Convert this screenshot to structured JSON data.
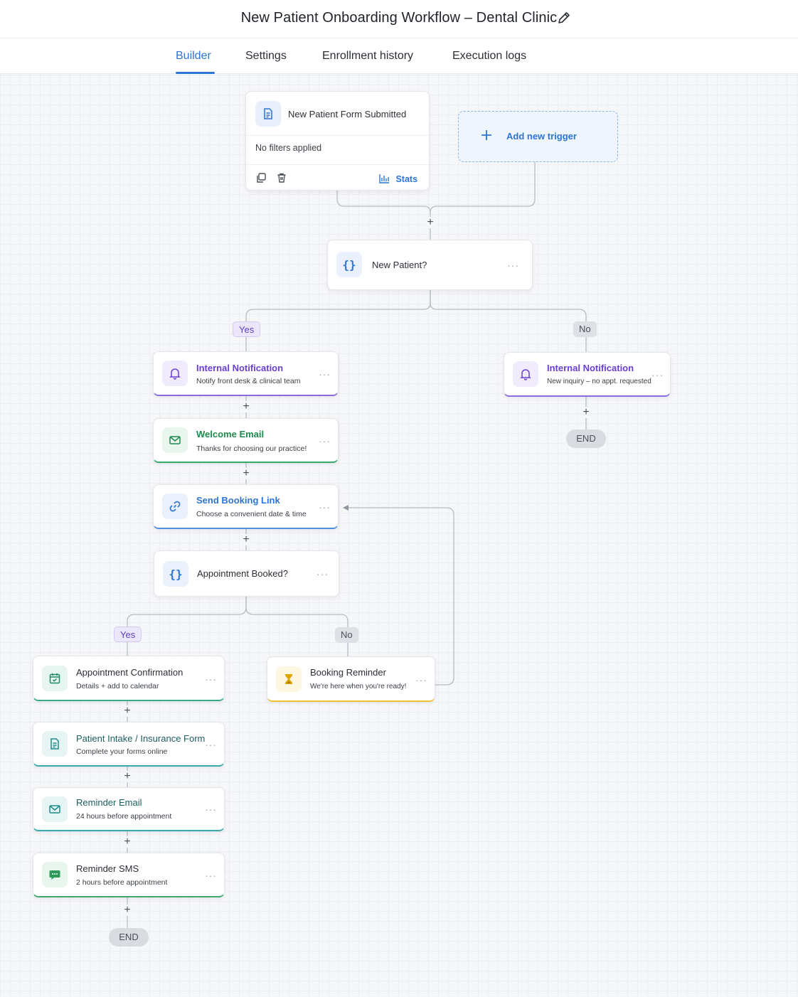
{
  "header": {
    "title": "New Patient Onboarding Workflow – Dental Clinic",
    "edit_icon": "pencil-icon"
  },
  "tabs": [
    {
      "label": "Builder",
      "active": true
    },
    {
      "label": "Settings",
      "active": false
    },
    {
      "label": "Enrollment history",
      "active": false
    },
    {
      "label": "Execution logs",
      "active": false
    }
  ],
  "trigger": {
    "title": "New Patient Form Submitted",
    "icon": "document-icon",
    "filters": "No filters applied",
    "stats_label": "Stats"
  },
  "add_trigger": {
    "label": "Add new trigger"
  },
  "condition1": {
    "title": "New Patient?",
    "icon": "braces-icon"
  },
  "branch_labels": {
    "yes": "Yes",
    "no": "No"
  },
  "yes_branch": [
    {
      "title": "Internal Notification",
      "subtitle": "Notify front desk & clinical team",
      "icon": "bell-icon",
      "color": "#6a3fd0"
    },
    {
      "title": "Welcome Email",
      "subtitle": "Thanks for choosing our practice!",
      "icon": "mail-icon",
      "color": "#1e8a4c"
    },
    {
      "title": "Send Booking Link",
      "subtitle": "Choose a convenient date & time",
      "icon": "link-icon",
      "color": "#2c74d6"
    }
  ],
  "no_branch": {
    "title": "Internal Notification",
    "subtitle": "New inquiry – no appt. requested",
    "icon": "bell-icon",
    "color": "#6a3fd0",
    "end_label": "END"
  },
  "condition2": {
    "title": "Appointment Booked?",
    "icon": "braces-icon"
  },
  "booked_branch": [
    {
      "title": "Appointment Confirmation",
      "subtitle": "Details + add to calendar",
      "icon": "calendar-icon",
      "color": "#1e8a6a"
    },
    {
      "title": "Patient Intake / Insurance Form",
      "subtitle": "Complete your forms online",
      "icon": "form-icon",
      "color": "#1e8a8a"
    },
    {
      "title": "Reminder Email",
      "subtitle": "24 hours before appointment",
      "icon": "mail-icon",
      "color": "#1e8a8a"
    },
    {
      "title": "Reminder SMS",
      "subtitle": "2 hours before appointment",
      "icon": "chat-icon",
      "color": "#1e8a4c"
    }
  ],
  "not_booked_branch": {
    "title": "Booking Reminder",
    "subtitle": "We're here when you're ready!",
    "icon": "hourglass-icon",
    "color": "#e0a400"
  },
  "end_label": "END",
  "colors": {
    "accent": "#2c74d6",
    "purple": "#6a3fd0",
    "green": "#1e8a4c",
    "teal": "#1e8a8a",
    "amber": "#e0a400"
  }
}
